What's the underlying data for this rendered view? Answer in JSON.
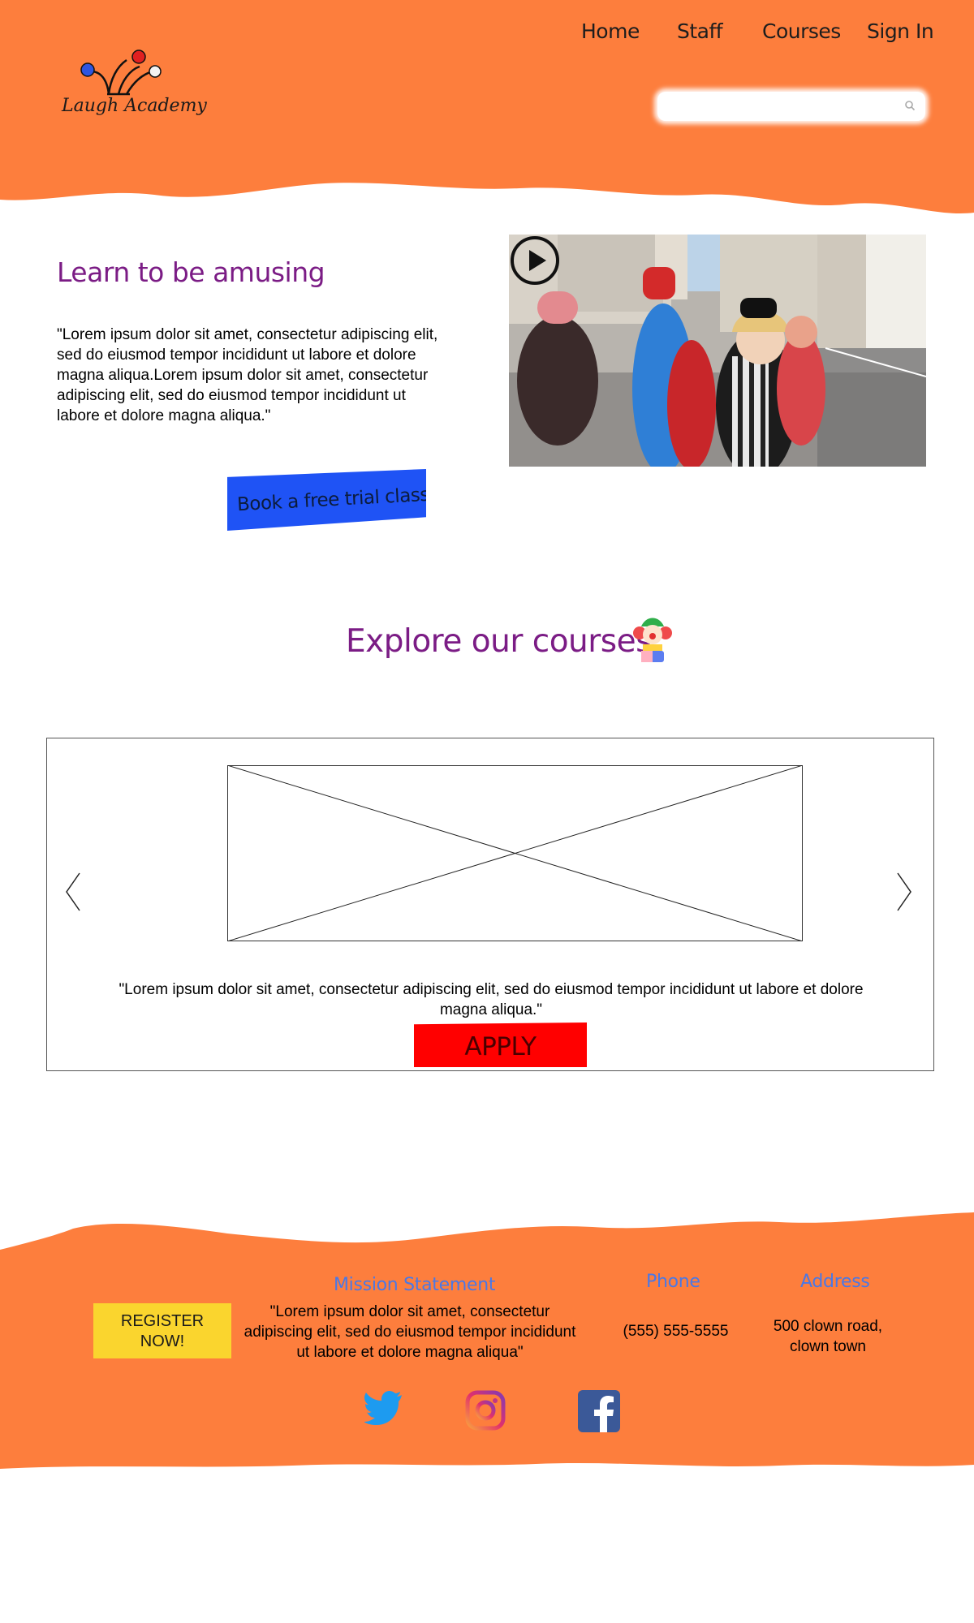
{
  "header": {
    "logo_text": "Laugh Academy",
    "nav": [
      {
        "label": "Home"
      },
      {
        "label": "Staff"
      },
      {
        "label": "Courses"
      },
      {
        "label": "Sign In"
      }
    ],
    "search": {
      "placeholder": ""
    }
  },
  "hero": {
    "title": "Learn to be amusing",
    "text": "\"Lorem ipsum dolor sit amet, consectetur adipiscing elit, sed do eiusmod tempor incididunt ut labore et dolore magna aliqua.Lorem ipsum dolor sit amet, consectetur adipiscing elit, sed do eiusmod tempor incididunt ut labore et dolore magna aliqua.\"",
    "cta_label": "Book a free trial class"
  },
  "courses": {
    "title": "Explore our courses",
    "carousel_text": "\"Lorem ipsum dolor sit amet, consectetur adipiscing elit, sed do eiusmod tempor incididunt ut labore et dolore magna aliqua.\"",
    "apply_label": "APPLY"
  },
  "footer": {
    "register_label": "REGISTER\nNOW!",
    "mission_heading": "Mission Statement",
    "mission_text": "\"Lorem ipsum dolor sit amet, consectetur adipiscing elit, sed do eiusmod tempor incididunt ut labore et dolore magna aliqua\"",
    "phone_heading": "Phone",
    "phone_value": "(555) 555-5555",
    "address_heading": "Address",
    "address_value": "500 clown road, clown town",
    "social_icons": [
      "twitter-icon",
      "instagram-icon",
      "facebook-icon"
    ]
  },
  "colors": {
    "header_orange": "#fd7e3d",
    "title_purple": "#7b1c85",
    "trial_blue": "#1f53f5",
    "apply_red": "#ff0000",
    "register_yellow": "#fad52e",
    "footer_heading_blue": "#4a78e6"
  }
}
